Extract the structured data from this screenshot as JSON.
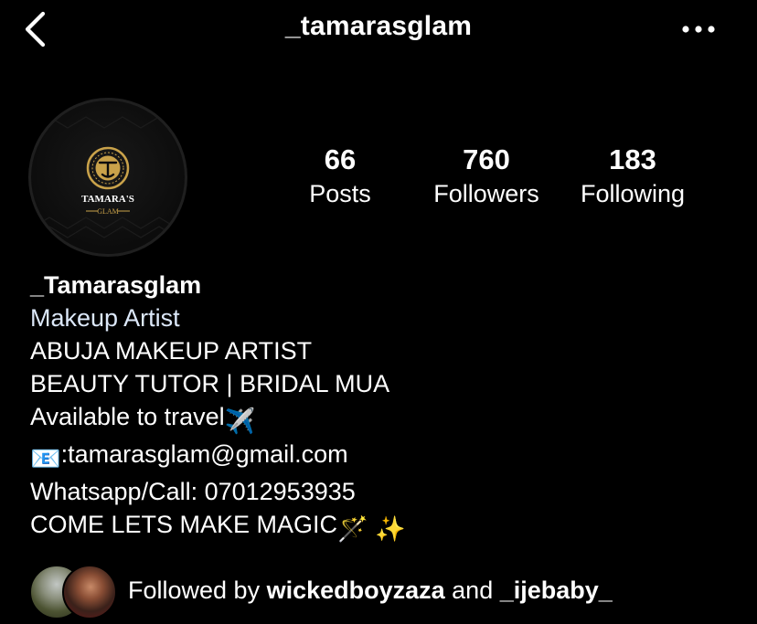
{
  "header": {
    "username": "_tamarasglam",
    "back_icon": "chevron-left-icon",
    "more_icon": "more-horizontal-icon"
  },
  "avatar": {
    "brand_line1": "TAMARA'S",
    "brand_line2": "GLAM",
    "brand_color": "#c9a24a"
  },
  "stats": [
    {
      "value": "66",
      "label": "Posts"
    },
    {
      "value": "760",
      "label": "Followers"
    },
    {
      "value": "183",
      "label": "Following"
    }
  ],
  "bio": {
    "name": "_Tamarasglam",
    "category": "Makeup Artist",
    "lines": {
      "l1": "ABUJA MAKEUP ARTIST",
      "l2": "BEAUTY TUTOR | BRIDAL MUA",
      "l3": "Available to travel",
      "l4": ":tamarasglam@gmail.com",
      "l5": "Whatsapp/Call: 07012953935",
      "l6": "COME LETS MAKE MAGIC"
    },
    "emojis": {
      "airplane": "✈️",
      "email": "📧",
      "wand": "🪄",
      "sparkles": "✨"
    }
  },
  "followed_by": {
    "prefix": "Followed by ",
    "user1": "wickedboyzaza",
    "joiner": " and ",
    "user2": "_ijebaby_"
  },
  "colors": {
    "background": "#000000",
    "text": "#ffffff",
    "category": "#dce8f9"
  }
}
